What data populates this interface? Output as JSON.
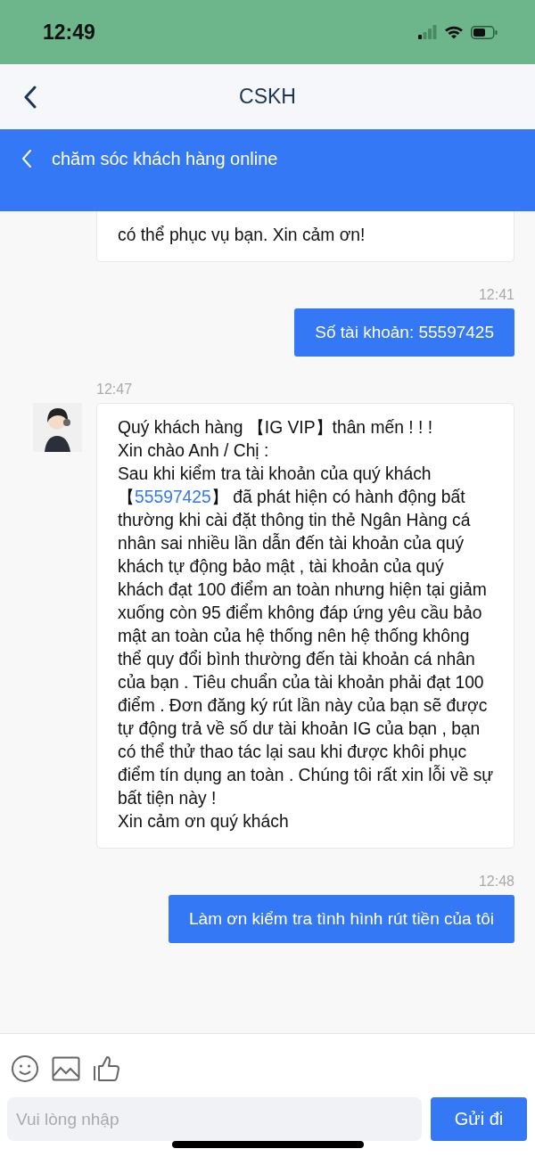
{
  "status_bar": {
    "time": "12:49"
  },
  "nav": {
    "title": "CSKH"
  },
  "banner": {
    "title": "chăm sóc khách hàng online"
  },
  "messages": [
    {
      "kind": "received",
      "lines": [
        [
          {
            "text": "có thể phục vụ bạn. Xin cảm ơn!"
          }
        ]
      ],
      "cut_top": true
    },
    {
      "kind": "time",
      "text": "12:41"
    },
    {
      "kind": "sent",
      "text": "Số tài khoản: 55597425"
    },
    {
      "kind": "time",
      "text": "12:47"
    },
    {
      "kind": "received",
      "avatar": true,
      "lines": [
        [
          {
            "text": "Quý khách hàng 【IG VIP】thân mến ! ! !"
          }
        ],
        [
          {
            "text": "Xin chào Anh / Chị :"
          }
        ],
        [
          {
            "text": "Sau khi kiểm tra tài khoản của quý khách 【"
          },
          {
            "text": "55597425",
            "kind": "link"
          },
          {
            "text": "】 đã phát hiện có hành động bất thường khi cài đặt thông tin thẻ Ngân Hàng cá nhân sai nhiều lần dẫn đến tài khoản của quý khách tự động bảo mật , tài khoản của quý khách đạt 100 điểm an toàn nhưng hiện tại giảm xuống còn 95 điểm không đáp ứng yêu cầu bảo mật an toàn của hệ thống nên hệ thống không thể quy đổi bình thường đến tài khoản cá nhân của bạn . Tiêu chuẩn của tài khoản phải đạt 100 điểm . Đơn đăng ký rút lần này của bạn sẽ được tự động trả về số dư tài khoản IG của bạn , bạn có thể thử thao tác lại sau khi được khôi phục điểm tín dụng an toàn . Chúng tôi rất xin lỗi về sự bất tiện này !"
          }
        ],
        [
          {
            "text": "Xin cảm ơn quý khách"
          }
        ]
      ]
    },
    {
      "kind": "time",
      "text": "12:48"
    },
    {
      "kind": "sent",
      "text": "Làm ơn kiểm tra tình hình rút tiền của tôi"
    }
  ],
  "composer": {
    "placeholder": "Vui lòng nhập",
    "send": "Gửi đi"
  }
}
